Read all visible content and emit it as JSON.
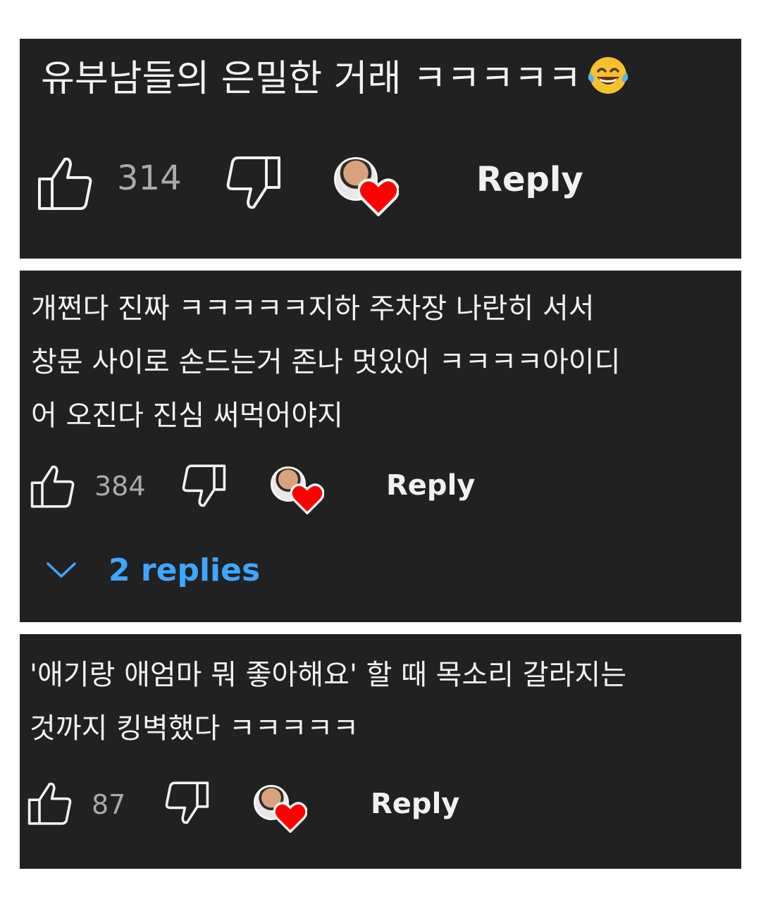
{
  "comments": [
    {
      "lines": [
        "유부남들의 은밀한 거래 ㅋㅋㅋㅋㅋ"
      ],
      "emoji": "laughing-tears-emoji",
      "likes": "314",
      "reply_label": "Reply"
    },
    {
      "lines": [
        "개쩐다 진짜 ㅋㅋㅋㅋㅋ지하 주차장 나란히 서서",
        "창문 사이로 손드는거 존나 멋있어 ㅋㅋㅋㅋ아이디",
        "어 오진다 진심 써먹어야지"
      ],
      "likes": "384",
      "reply_label": "Reply",
      "replies_label": "2 replies"
    },
    {
      "lines": [
        "'애기랑 애엄마 뭐 좋아해요' 할 때 목소리 갈라지는",
        "것까지 킹벽했다 ㅋㅋㅋㅋㅋ"
      ],
      "likes": "87",
      "reply_label": "Reply"
    }
  ],
  "icons": {
    "like": "thumbs-up-icon",
    "dislike": "thumbs-down-icon",
    "creator_heart": "creator-heart-icon",
    "expand": "chevron-down-icon"
  },
  "colors": {
    "card_background": "#212121",
    "text": "#f1f1f1",
    "count": "#aaaaaa",
    "link_blue": "#3ea6ff",
    "heart_red": "#ff0000"
  }
}
